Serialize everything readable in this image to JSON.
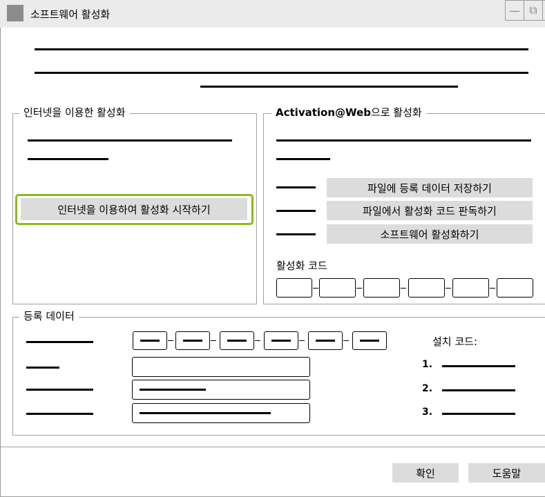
{
  "window": {
    "title": "소프트웨어 활성화",
    "controls": {
      "minimize": "—",
      "restore": "⧉",
      "close": "✕"
    }
  },
  "internet_section": {
    "legend": "인터넷을 이용한 활성화",
    "start_button": "인터넷을 이용하여 활성화 시작하기"
  },
  "web_section": {
    "legend_bold": "Activation@Web",
    "legend_rest": "으로 활성화",
    "buttons": [
      "파일에 등록 데이터 저장하기",
      "파일에서 활성화 코드 판독하기",
      "소프트웨어 활성화하기"
    ],
    "code_label": "활성화 코드",
    "code_boxes": 6
  },
  "registration_section": {
    "legend": "등록 데이터",
    "install_code_label": "설치 코드:",
    "install_items": [
      "1.",
      "2.",
      "3."
    ]
  },
  "footer": {
    "ok_button": "확인",
    "help_button": "도움말"
  },
  "colors": {
    "highlight": "#8cb81e",
    "button_bg": "#dcdcdc",
    "titlebar_bg": "#ebebeb"
  }
}
